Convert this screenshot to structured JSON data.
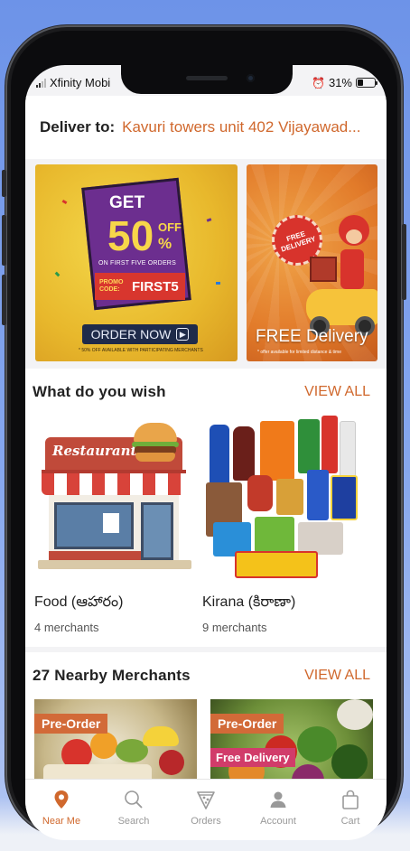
{
  "status_bar": {
    "carrier": "Xfinity Mobi",
    "battery": "31%"
  },
  "deliver": {
    "label": "Deliver to:",
    "address": "Kavuri towers unit 402 Vijayawad..."
  },
  "banners": [
    {
      "get": "GET",
      "percent_value": "50",
      "off": "OFF",
      "percent_sign": "%",
      "first_orders": "ON FIRST FIVE ORDERS",
      "promo_label": "PROMO CODE:",
      "promo_code": "FIRST5",
      "button": "ORDER NOW",
      "fine_print": "* 50% OFF AVAILABLE WITH PARTICIPATING MERCHANTS"
    },
    {
      "seal": "FREE DELIVERY",
      "headline": "FREE Delivery",
      "fine_print": "* offer available for limited distance & time"
    }
  ],
  "wish": {
    "title": "What do you wish",
    "view_all": "VIEW ALL",
    "categories": [
      {
        "name": "Food (ఆహారం)",
        "count": "4 merchants",
        "sign": "Restaurant"
      },
      {
        "name": "Kirana (కిరాణా)",
        "count": "9 merchants"
      }
    ]
  },
  "nearby": {
    "title": "27 Nearby Merchants",
    "view_all": "VIEW ALL",
    "cards": [
      {
        "tag": "Pre-Order"
      },
      {
        "tag": "Pre-Order",
        "tag2": "Free Delivery"
      }
    ]
  },
  "tabs": [
    {
      "label": "Near Me",
      "icon": "location-pin-icon",
      "active": true
    },
    {
      "label": "Search",
      "icon": "search-icon",
      "active": false
    },
    {
      "label": "Orders",
      "icon": "pizza-slice-icon",
      "active": false
    },
    {
      "label": "Account",
      "icon": "person-icon",
      "active": false
    },
    {
      "label": "Cart",
      "icon": "shopping-bag-icon",
      "active": false
    }
  ],
  "colors": {
    "accent": "#d0682d",
    "banner_purple": "#6c2e8f",
    "tag_orange": "#d26a38",
    "tag_pink": "#d13c6a"
  }
}
